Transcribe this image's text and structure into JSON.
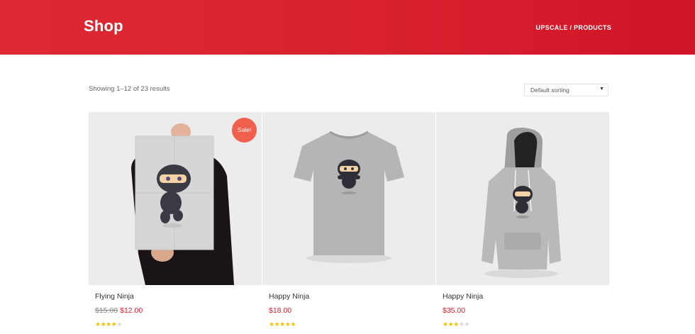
{
  "header": {
    "title": "Shop",
    "breadcrumb": {
      "home": "UPSCALE",
      "separator": "/",
      "current": "PRODUCTS"
    }
  },
  "toolbar": {
    "result_count": "Showing 1–12 of 23 results",
    "sorting_selected": "Default sorting"
  },
  "products": [
    {
      "name": "Flying Ninja",
      "regular_price": "$15.00",
      "price": "$12.00",
      "on_sale": true,
      "sale_label": "Sale!",
      "rating": 4,
      "rating_max": 5,
      "image_icon": "ninja-poster-image"
    },
    {
      "name": "Happy Ninja",
      "price": "$18.00",
      "on_sale": false,
      "rating": 5,
      "rating_max": 5,
      "image_icon": "ninja-tshirt-image"
    },
    {
      "name": "Happy Ninja",
      "price": "$35.00",
      "on_sale": false,
      "rating": 3,
      "rating_max": 5,
      "image_icon": "ninja-hoodie-image"
    }
  ],
  "colors": {
    "brand": "#d71f2e",
    "sale_badge": "#f0604d",
    "star": "#f2c400"
  }
}
